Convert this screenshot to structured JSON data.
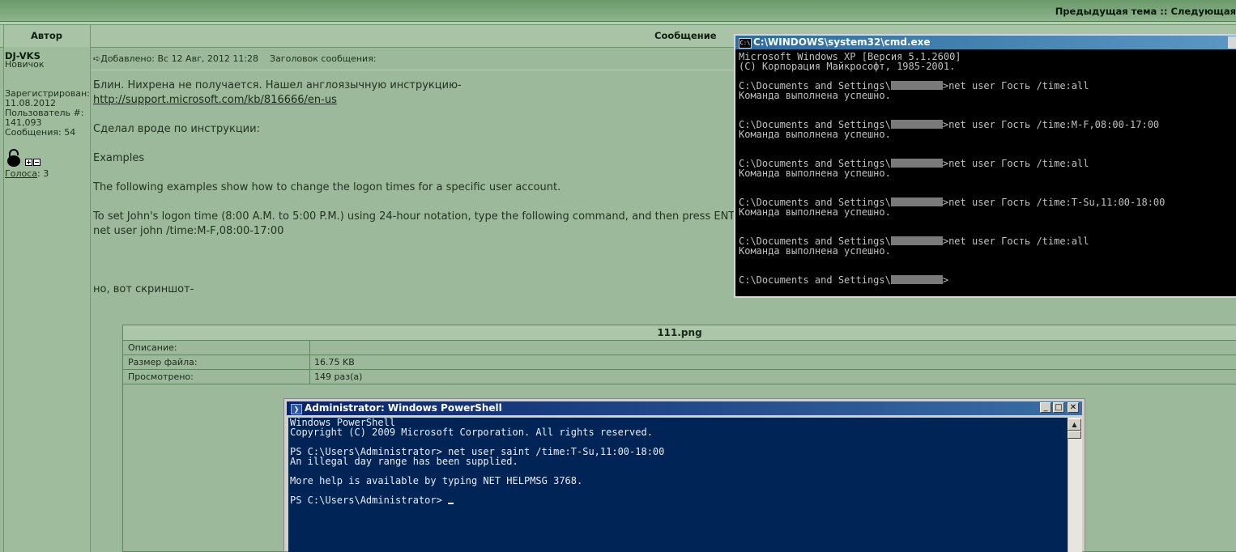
{
  "topbar": {
    "nav_text": "Предыдущая тема :: Следующая"
  },
  "header": {
    "author_col": "Автор",
    "message_col": "Сообщение"
  },
  "author": {
    "name": "DJ-VKS",
    "rank": "Новичок",
    "registered_label": "Зарегистрирован:",
    "registered_date": "11.08.2012",
    "user_no_label": "Пользователь #:",
    "user_no": "141,093",
    "messages_label": "Сообщения: 54",
    "votes_link": "Голоса",
    "votes_count": ": 3"
  },
  "post": {
    "meta": "Добавлено: Вс 12 Авг, 2012 11:28    Заголовок сообщения:",
    "lines": [
      "Блин. Нихрена не получается. Нашел англоязычную инструкцию-",
      "http://support.microsoft.com/kb/816666/en-us",
      "Сделал вроде по инструкции:",
      "Examples",
      "The following examples show how to change the logon times for a specific user account.",
      "To set John's logon time (8:00 A.M. to 5:00 P.M.) using 24-hour notation, type the following command, and then press ENTER:",
      "net user john /time:M-F,08:00-17:00",
      "но, вот скриншот-"
    ]
  },
  "attachment": {
    "filename": "111.png",
    "rows": [
      {
        "label": "Описание:",
        "value": ""
      },
      {
        "label": "Размер файла:",
        "value": "16.75 KB"
      },
      {
        "label": "Просмотрено:",
        "value": "149 раз(а)"
      }
    ]
  },
  "cmd": {
    "title": "C:\\WINDOWS\\system32\\cmd.exe",
    "icon_text": "C:\\",
    "lines": [
      "Microsoft Windows XP [Версия 5.1.2600]",
      "(С) Корпорация Майкрософт, 1985-2001.",
      "",
      "C:\\Documents and Settings\\",
      "Команда выполнена успешно.",
      "",
      "",
      "C:\\Documents and Settings\\",
      "Команда выполнена успешно.",
      "",
      "",
      "C:\\Documents and Settings\\",
      "Команда выполнена успешно.",
      "",
      "",
      "C:\\Documents and Settings\\",
      "Команда выполнена успешно.",
      "",
      "",
      "C:\\Documents and Settings\\",
      "Команда выполнена успешно.",
      "",
      "",
      "C:\\Documents and Settings\\"
    ],
    "cmd_suffixes": [
      ">net user Гость /time:all",
      ">net user Гость /time:M-F,08:00-17:00",
      ">net user Гость /time:all",
      ">net user Гость /time:T-Su,11:00-18:00",
      ">net user Гость /time:all",
      ">"
    ]
  },
  "powershell": {
    "title": "Administrator: Windows PowerShell",
    "minimize": "_",
    "maximize": "□",
    "close": "✕",
    "lines": [
      "Windows PowerShell",
      "Copyright (C) 2009 Microsoft Corporation. All rights reserved.",
      "",
      "PS C:\\Users\\Administrator> net user saint /time:T-Su,11:00-18:00",
      "An illegal day range has been supplied.",
      "",
      "More help is available by typing NET HELPMSG 3768.",
      "",
      "PS C:\\Users\\Administrator> "
    ]
  }
}
